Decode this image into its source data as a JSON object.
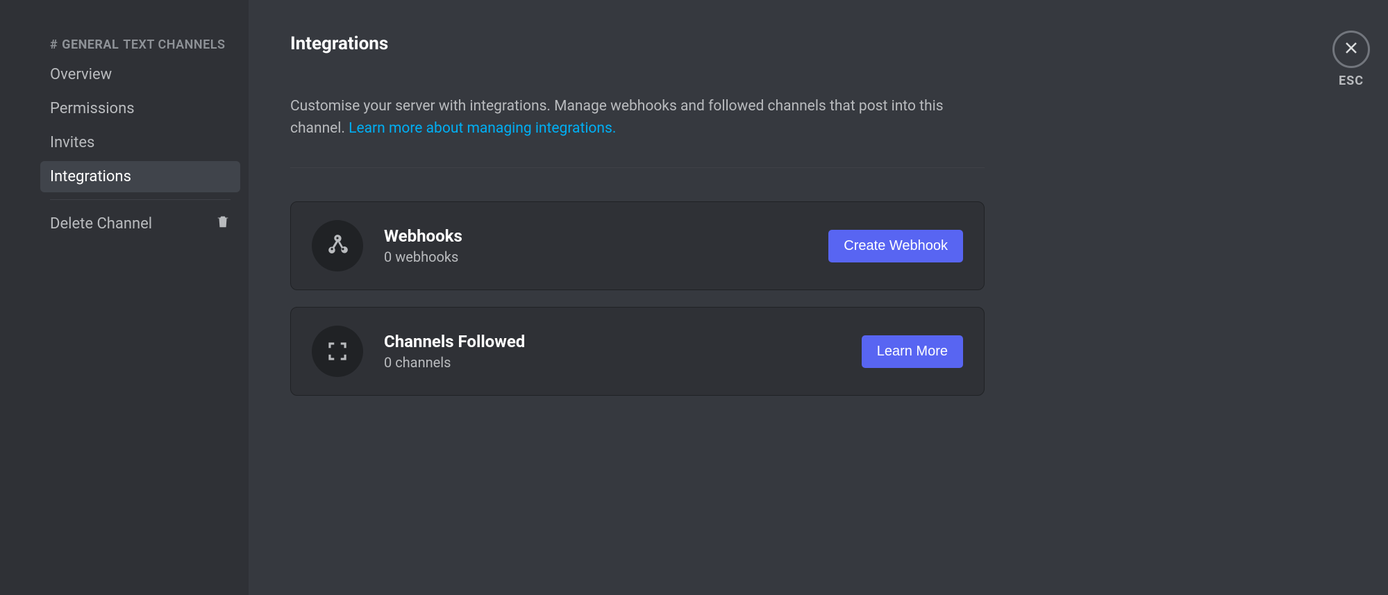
{
  "sidebar": {
    "header_prefix": "#",
    "header_channel": "GENERAL",
    "header_suffix": "TEXT CHANNELS",
    "items": [
      {
        "label": "Overview",
        "active": false
      },
      {
        "label": "Permissions",
        "active": false
      },
      {
        "label": "Invites",
        "active": false
      },
      {
        "label": "Integrations",
        "active": true
      }
    ],
    "delete_label": "Delete Channel"
  },
  "page": {
    "title": "Integrations",
    "description_text": "Customise your server with integrations. Manage webhooks and followed channels that post into this channel. ",
    "description_link": "Learn more about managing integrations."
  },
  "cards": {
    "webhooks": {
      "title": "Webhooks",
      "subtitle": "0 webhooks",
      "button": "Create Webhook"
    },
    "channels_followed": {
      "title": "Channels Followed",
      "subtitle": "0 channels",
      "button": "Learn More"
    }
  },
  "close": {
    "label": "ESC"
  }
}
